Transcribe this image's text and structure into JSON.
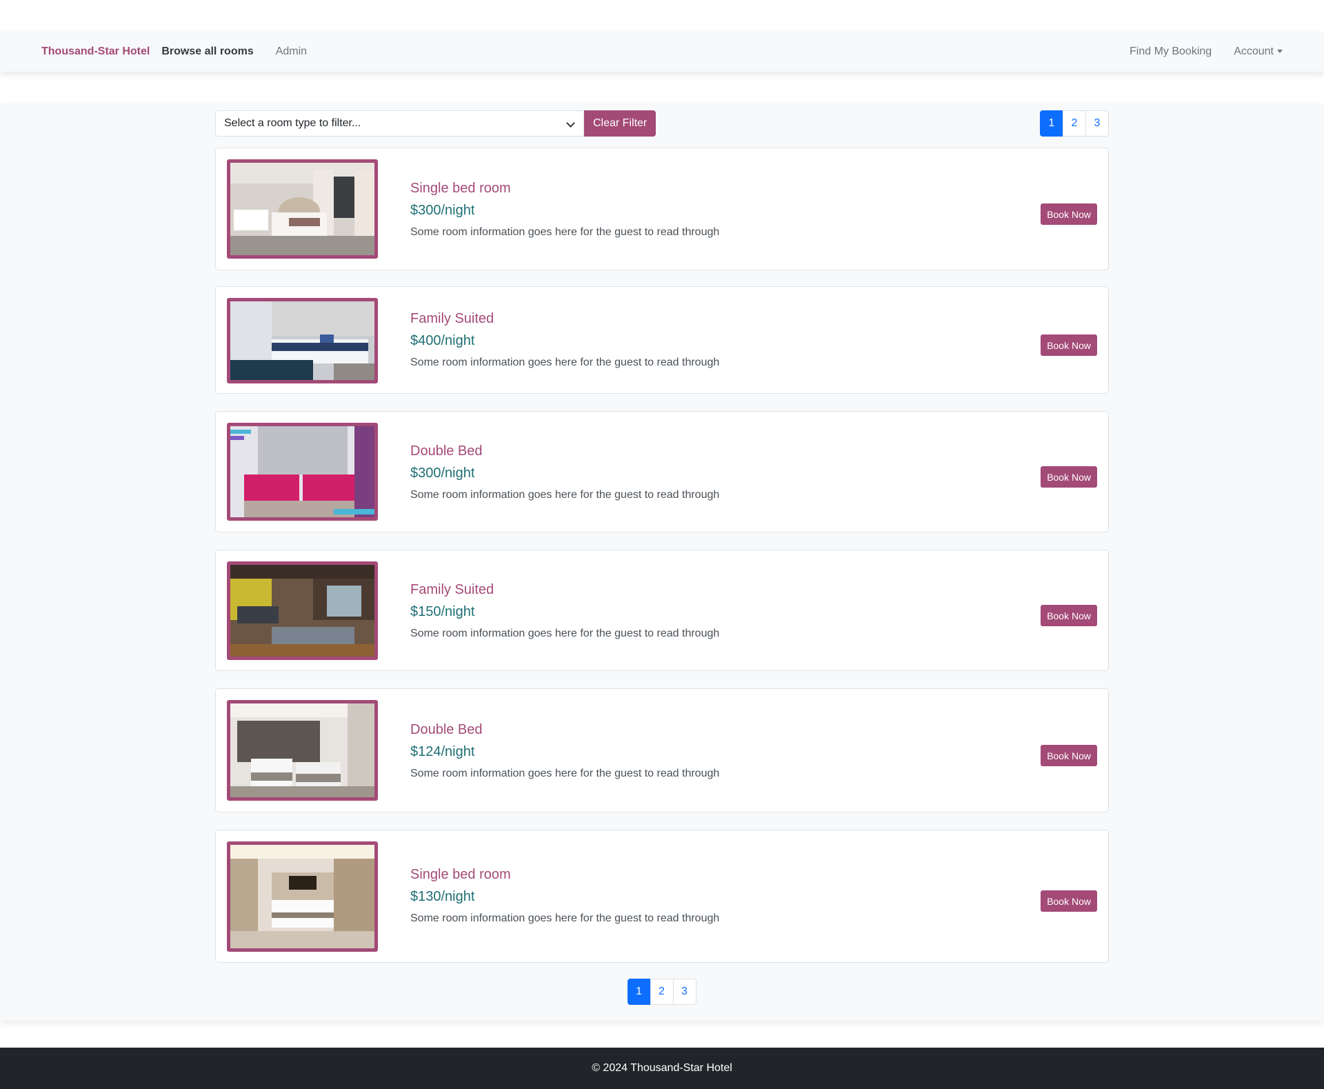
{
  "nav": {
    "brand": "Thousand-Star Hotel",
    "browse": "Browse all rooms",
    "admin": "Admin",
    "find_booking": "Find My Booking",
    "account": "Account"
  },
  "filter": {
    "select_placeholder": "Select a room type to filter...",
    "clear_label": "Clear Filter"
  },
  "pagination": {
    "pages": [
      "1",
      "2",
      "3"
    ],
    "current": "1"
  },
  "rooms": [
    {
      "title": "Single bed room",
      "price": "$300/night",
      "desc": "Some room information goes here for the guest to read through",
      "book": "Book Now"
    },
    {
      "title": "Family Suited",
      "price": "$400/night",
      "desc": "Some room information goes here for the guest to read through",
      "book": "Book Now"
    },
    {
      "title": "Double Bed",
      "price": "$300/night",
      "desc": "Some room information goes here for the guest to read through",
      "book": "Book Now"
    },
    {
      "title": "Family Suited",
      "price": "$150/night",
      "desc": "Some room information goes here for the guest to read through",
      "book": "Book Now"
    },
    {
      "title": "Double Bed",
      "price": "$124/night",
      "desc": "Some room information goes here for the guest to read through",
      "book": "Book Now"
    },
    {
      "title": "Single bed room",
      "price": "$130/night",
      "desc": "Some room information goes here for the guest to read through",
      "book": "Book Now"
    }
  ],
  "footer": {
    "text": "© 2024 Thousand-Star Hotel"
  },
  "colors": {
    "accent": "#a34a77",
    "price": "#1f6f74",
    "page_active": "#0d6efd",
    "footer_bg": "#212529"
  }
}
